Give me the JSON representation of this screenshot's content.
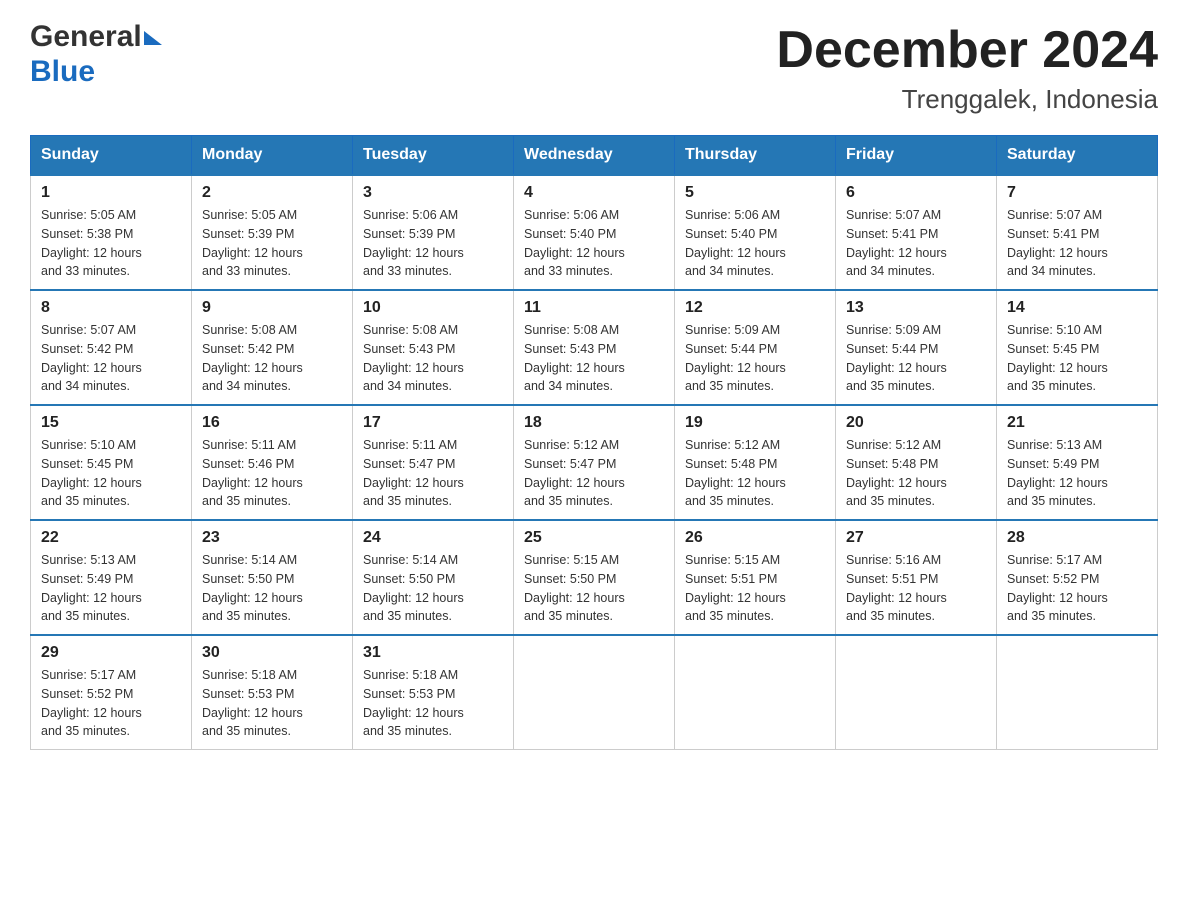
{
  "header": {
    "title": "December 2024",
    "subtitle": "Trenggalek, Indonesia",
    "logo_general": "General",
    "logo_blue": "Blue"
  },
  "days_of_week": [
    "Sunday",
    "Monday",
    "Tuesday",
    "Wednesday",
    "Thursday",
    "Friday",
    "Saturday"
  ],
  "weeks": [
    [
      {
        "day": 1,
        "sunrise": "5:05 AM",
        "sunset": "5:38 PM",
        "daylight": "12 hours and 33 minutes."
      },
      {
        "day": 2,
        "sunrise": "5:05 AM",
        "sunset": "5:39 PM",
        "daylight": "12 hours and 33 minutes."
      },
      {
        "day": 3,
        "sunrise": "5:06 AM",
        "sunset": "5:39 PM",
        "daylight": "12 hours and 33 minutes."
      },
      {
        "day": 4,
        "sunrise": "5:06 AM",
        "sunset": "5:40 PM",
        "daylight": "12 hours and 33 minutes."
      },
      {
        "day": 5,
        "sunrise": "5:06 AM",
        "sunset": "5:40 PM",
        "daylight": "12 hours and 34 minutes."
      },
      {
        "day": 6,
        "sunrise": "5:07 AM",
        "sunset": "5:41 PM",
        "daylight": "12 hours and 34 minutes."
      },
      {
        "day": 7,
        "sunrise": "5:07 AM",
        "sunset": "5:41 PM",
        "daylight": "12 hours and 34 minutes."
      }
    ],
    [
      {
        "day": 8,
        "sunrise": "5:07 AM",
        "sunset": "5:42 PM",
        "daylight": "12 hours and 34 minutes."
      },
      {
        "day": 9,
        "sunrise": "5:08 AM",
        "sunset": "5:42 PM",
        "daylight": "12 hours and 34 minutes."
      },
      {
        "day": 10,
        "sunrise": "5:08 AM",
        "sunset": "5:43 PM",
        "daylight": "12 hours and 34 minutes."
      },
      {
        "day": 11,
        "sunrise": "5:08 AM",
        "sunset": "5:43 PM",
        "daylight": "12 hours and 34 minutes."
      },
      {
        "day": 12,
        "sunrise": "5:09 AM",
        "sunset": "5:44 PM",
        "daylight": "12 hours and 35 minutes."
      },
      {
        "day": 13,
        "sunrise": "5:09 AM",
        "sunset": "5:44 PM",
        "daylight": "12 hours and 35 minutes."
      },
      {
        "day": 14,
        "sunrise": "5:10 AM",
        "sunset": "5:45 PM",
        "daylight": "12 hours and 35 minutes."
      }
    ],
    [
      {
        "day": 15,
        "sunrise": "5:10 AM",
        "sunset": "5:45 PM",
        "daylight": "12 hours and 35 minutes."
      },
      {
        "day": 16,
        "sunrise": "5:11 AM",
        "sunset": "5:46 PM",
        "daylight": "12 hours and 35 minutes."
      },
      {
        "day": 17,
        "sunrise": "5:11 AM",
        "sunset": "5:47 PM",
        "daylight": "12 hours and 35 minutes."
      },
      {
        "day": 18,
        "sunrise": "5:12 AM",
        "sunset": "5:47 PM",
        "daylight": "12 hours and 35 minutes."
      },
      {
        "day": 19,
        "sunrise": "5:12 AM",
        "sunset": "5:48 PM",
        "daylight": "12 hours and 35 minutes."
      },
      {
        "day": 20,
        "sunrise": "5:12 AM",
        "sunset": "5:48 PM",
        "daylight": "12 hours and 35 minutes."
      },
      {
        "day": 21,
        "sunrise": "5:13 AM",
        "sunset": "5:49 PM",
        "daylight": "12 hours and 35 minutes."
      }
    ],
    [
      {
        "day": 22,
        "sunrise": "5:13 AM",
        "sunset": "5:49 PM",
        "daylight": "12 hours and 35 minutes."
      },
      {
        "day": 23,
        "sunrise": "5:14 AM",
        "sunset": "5:50 PM",
        "daylight": "12 hours and 35 minutes."
      },
      {
        "day": 24,
        "sunrise": "5:14 AM",
        "sunset": "5:50 PM",
        "daylight": "12 hours and 35 minutes."
      },
      {
        "day": 25,
        "sunrise": "5:15 AM",
        "sunset": "5:50 PM",
        "daylight": "12 hours and 35 minutes."
      },
      {
        "day": 26,
        "sunrise": "5:15 AM",
        "sunset": "5:51 PM",
        "daylight": "12 hours and 35 minutes."
      },
      {
        "day": 27,
        "sunrise": "5:16 AM",
        "sunset": "5:51 PM",
        "daylight": "12 hours and 35 minutes."
      },
      {
        "day": 28,
        "sunrise": "5:17 AM",
        "sunset": "5:52 PM",
        "daylight": "12 hours and 35 minutes."
      }
    ],
    [
      {
        "day": 29,
        "sunrise": "5:17 AM",
        "sunset": "5:52 PM",
        "daylight": "12 hours and 35 minutes."
      },
      {
        "day": 30,
        "sunrise": "5:18 AM",
        "sunset": "5:53 PM",
        "daylight": "12 hours and 35 minutes."
      },
      {
        "day": 31,
        "sunrise": "5:18 AM",
        "sunset": "5:53 PM",
        "daylight": "12 hours and 35 minutes."
      },
      null,
      null,
      null,
      null
    ]
  ],
  "labels": {
    "sunrise": "Sunrise:",
    "sunset": "Sunset:",
    "daylight": "Daylight:"
  }
}
